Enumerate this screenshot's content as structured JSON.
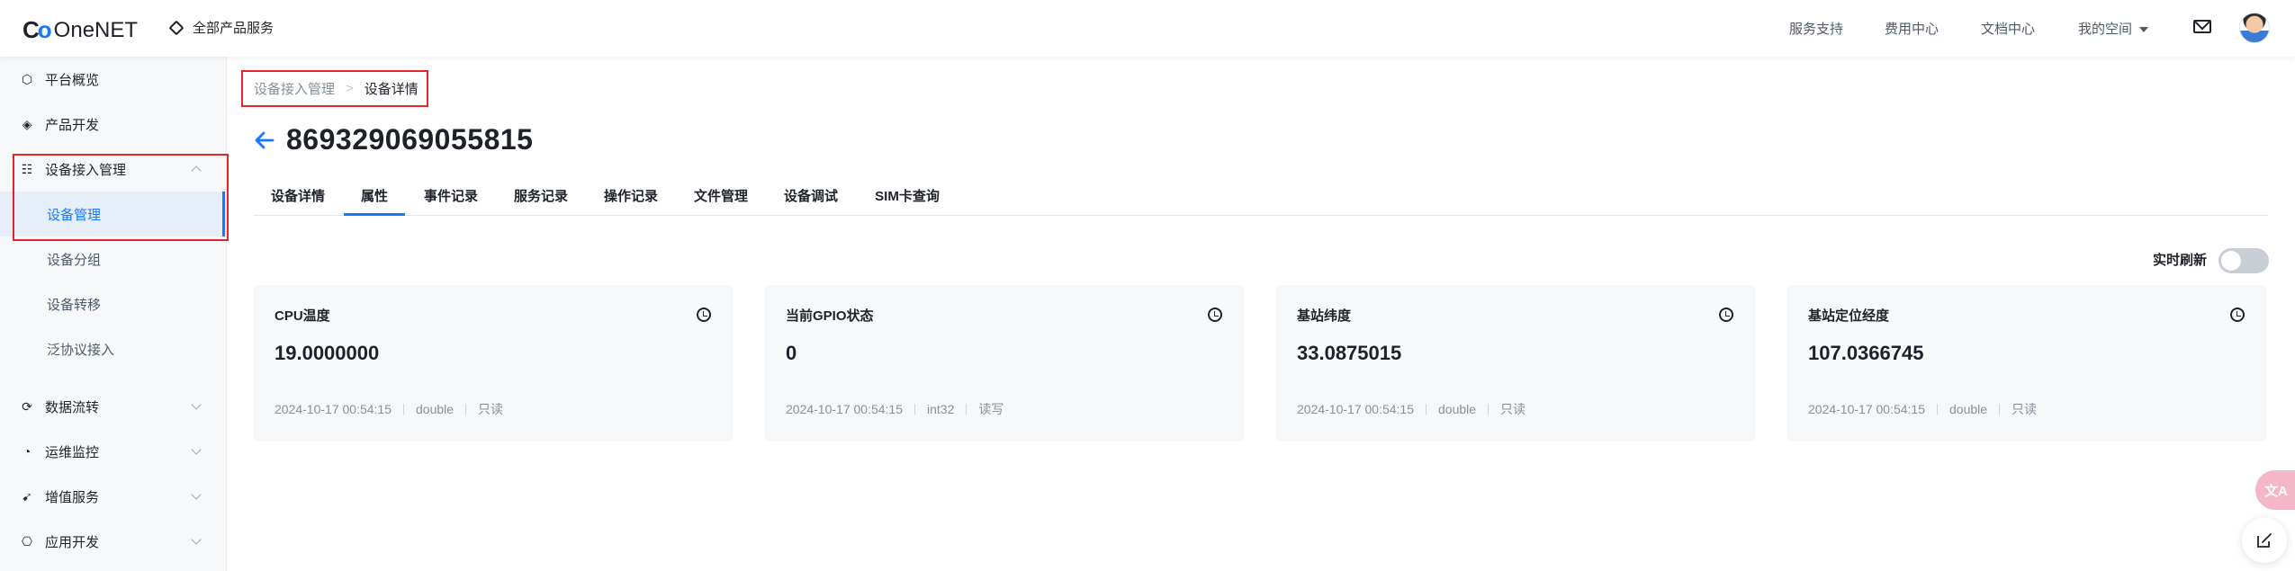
{
  "header": {
    "logo_mark": "CO",
    "logo_text": "OneNET",
    "all_products": "全部产品服务",
    "nav": [
      {
        "label": "服务支持"
      },
      {
        "label": "费用中心"
      },
      {
        "label": "文档中心"
      },
      {
        "label": "我的空间"
      }
    ]
  },
  "sidebar": {
    "items": [
      {
        "label": "平台概览",
        "icon": "overview-icon"
      },
      {
        "label": "产品开发",
        "icon": "cube-icon"
      },
      {
        "label": "设备接入管理",
        "icon": "device-access-icon"
      },
      {
        "label": "数据流转",
        "icon": "data-flow-icon"
      },
      {
        "label": "运维监控",
        "icon": "monitor-icon"
      },
      {
        "label": "增值服务",
        "icon": "value-added-icon"
      },
      {
        "label": "应用开发",
        "icon": "app-dev-icon"
      }
    ],
    "sub_items": [
      {
        "label": "设备管理"
      },
      {
        "label": "设备分组"
      },
      {
        "label": "设备转移"
      },
      {
        "label": "泛协议接入"
      }
    ]
  },
  "breadcrumb": {
    "parent": "设备接入管理",
    "separator": ">",
    "current": "设备详情"
  },
  "device": {
    "id": "869329069055815"
  },
  "tabs": [
    {
      "label": "设备详情"
    },
    {
      "label": "属性"
    },
    {
      "label": "事件记录"
    },
    {
      "label": "服务记录"
    },
    {
      "label": "操作记录"
    },
    {
      "label": "文件管理"
    },
    {
      "label": "设备调试"
    },
    {
      "label": "SIM卡查询"
    }
  ],
  "active_tab": "属性",
  "realtime_refresh": {
    "label": "实时刷新",
    "enabled": false
  },
  "properties": [
    {
      "name": "CPU温度",
      "value": "19.0000000",
      "time": "2024-10-17 00:54:15",
      "type": "double",
      "access": "只读"
    },
    {
      "name": "当前GPIO状态",
      "value": "0",
      "time": "2024-10-17 00:54:15",
      "type": "int32",
      "access": "读写"
    },
    {
      "name": "基站纬度",
      "value": "33.0875015",
      "time": "2024-10-17 00:54:15",
      "type": "double",
      "access": "只读"
    },
    {
      "name": "基站定位经度",
      "value": "107.0366745",
      "time": "2024-10-17 00:54:15",
      "type": "double",
      "access": "只读"
    }
  ],
  "float_translate_label": "文A",
  "colors": {
    "accent": "#1677ff",
    "highlight_border": "#e5242b",
    "card_bg": "#f7f8fa"
  }
}
